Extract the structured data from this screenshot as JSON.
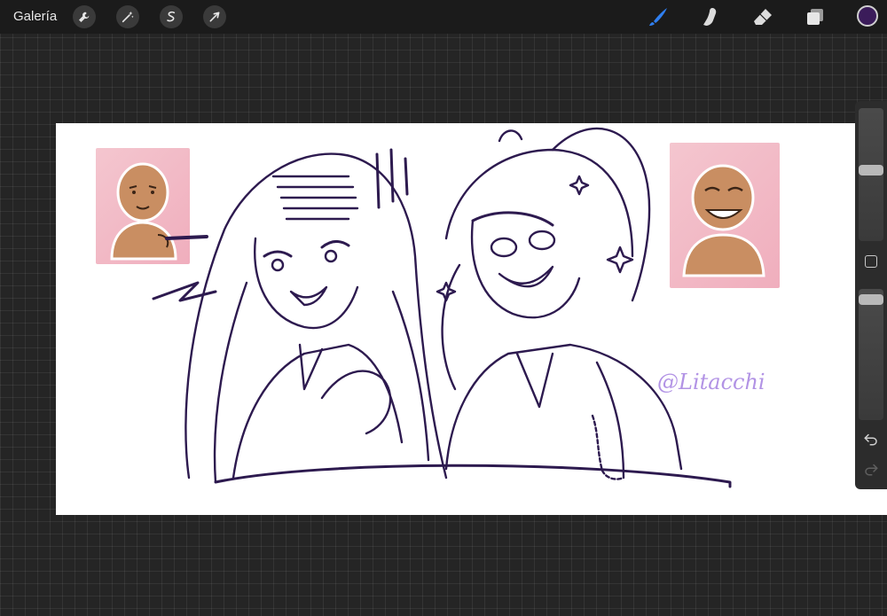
{
  "toolbar": {
    "gallery_label": "Galería",
    "left_tools": [
      {
        "name": "actions",
        "icon": "wrench-icon"
      },
      {
        "name": "adjustments",
        "icon": "magic-wand-icon"
      },
      {
        "name": "selection",
        "icon": "selection-s-icon"
      },
      {
        "name": "transform",
        "icon": "arrow-cursor-icon"
      }
    ],
    "right_tools": [
      {
        "name": "brush",
        "icon": "brush-icon",
        "active": true
      },
      {
        "name": "smudge",
        "icon": "smudge-finger-icon"
      },
      {
        "name": "eraser",
        "icon": "eraser-icon"
      },
      {
        "name": "layers",
        "icon": "layers-icon"
      }
    ],
    "active_tool_color": "#2f7ff0",
    "current_color": "#3b1c5a"
  },
  "canvas": {
    "watermark": "@Litacchi",
    "line_color": "#2d1a4f",
    "background": "#ffffff"
  },
  "sidebar": {
    "brush_size_icon": "size-slider",
    "modify_icon": "modify-square-icon",
    "undo_icon": "undo-arrow-icon",
    "redo_icon": "redo-arrow-icon"
  }
}
